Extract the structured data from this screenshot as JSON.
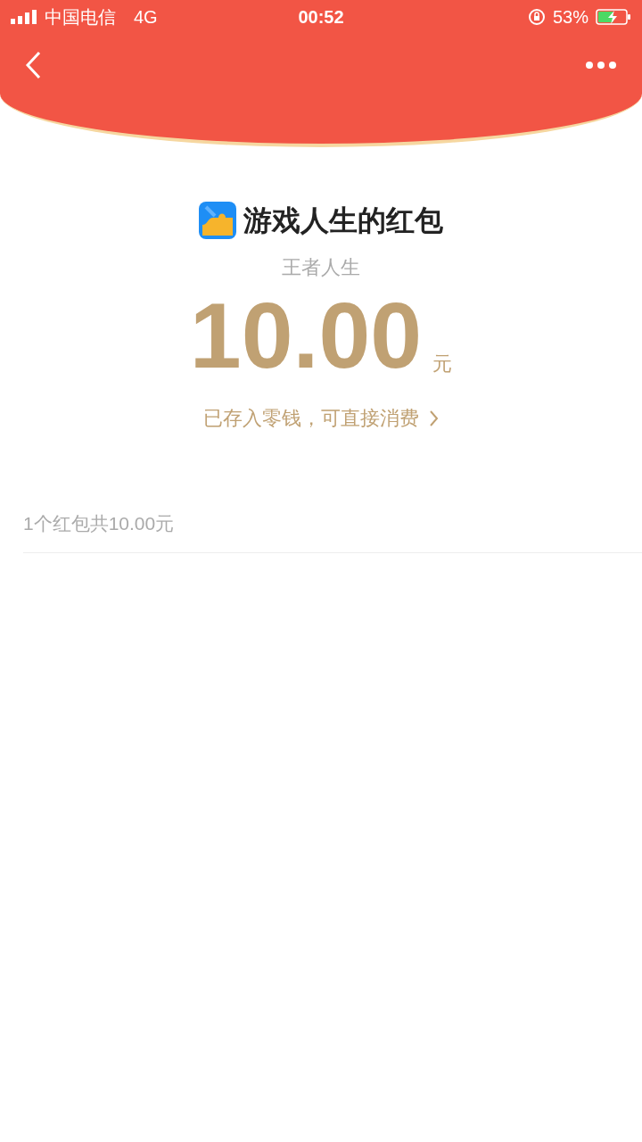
{
  "status_bar": {
    "carrier": "中国电信",
    "network": "4G",
    "time": "00:52",
    "battery": "53%"
  },
  "envelope": {
    "title": "游戏人生的红包",
    "sender": "王者人生",
    "amount": "10.00",
    "unit": "元",
    "note": "已存入零钱，可直接消费"
  },
  "summary": "1个红包共10.00元"
}
